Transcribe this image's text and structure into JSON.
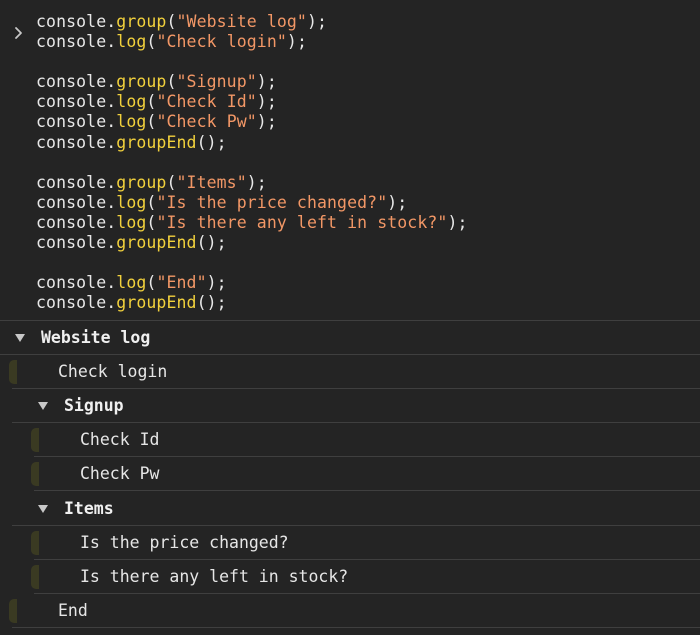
{
  "input": {
    "lines": [
      [
        {
          "t": "obj",
          "v": "console"
        },
        {
          "t": "dot",
          "v": "."
        },
        {
          "t": "fn",
          "v": "group"
        },
        {
          "t": "pun",
          "v": "("
        },
        {
          "t": "str",
          "v": "\"Website log\""
        },
        {
          "t": "pun",
          "v": ");"
        }
      ],
      [
        {
          "t": "obj",
          "v": "console"
        },
        {
          "t": "dot",
          "v": "."
        },
        {
          "t": "fn",
          "v": "log"
        },
        {
          "t": "pun",
          "v": "("
        },
        {
          "t": "str",
          "v": "\"Check login\""
        },
        {
          "t": "pun",
          "v": ");"
        }
      ],
      [],
      [
        {
          "t": "obj",
          "v": "console"
        },
        {
          "t": "dot",
          "v": "."
        },
        {
          "t": "fn",
          "v": "group"
        },
        {
          "t": "pun",
          "v": "("
        },
        {
          "t": "str",
          "v": "\"Signup\""
        },
        {
          "t": "pun",
          "v": ");"
        }
      ],
      [
        {
          "t": "obj",
          "v": "console"
        },
        {
          "t": "dot",
          "v": "."
        },
        {
          "t": "fn",
          "v": "log"
        },
        {
          "t": "pun",
          "v": "("
        },
        {
          "t": "str",
          "v": "\"Check Id\""
        },
        {
          "t": "pun",
          "v": ");"
        }
      ],
      [
        {
          "t": "obj",
          "v": "console"
        },
        {
          "t": "dot",
          "v": "."
        },
        {
          "t": "fn",
          "v": "log"
        },
        {
          "t": "pun",
          "v": "("
        },
        {
          "t": "str",
          "v": "\"Check Pw\""
        },
        {
          "t": "pun",
          "v": ");"
        }
      ],
      [
        {
          "t": "obj",
          "v": "console"
        },
        {
          "t": "dot",
          "v": "."
        },
        {
          "t": "fn",
          "v": "groupEnd"
        },
        {
          "t": "pun",
          "v": "();"
        }
      ],
      [],
      [
        {
          "t": "obj",
          "v": "console"
        },
        {
          "t": "dot",
          "v": "."
        },
        {
          "t": "fn",
          "v": "group"
        },
        {
          "t": "pun",
          "v": "("
        },
        {
          "t": "str",
          "v": "\"Items\""
        },
        {
          "t": "pun",
          "v": ");"
        }
      ],
      [
        {
          "t": "obj",
          "v": "console"
        },
        {
          "t": "dot",
          "v": "."
        },
        {
          "t": "fn",
          "v": "log"
        },
        {
          "t": "pun",
          "v": "("
        },
        {
          "t": "str",
          "v": "\"Is the price changed?\""
        },
        {
          "t": "pun",
          "v": ");"
        }
      ],
      [
        {
          "t": "obj",
          "v": "console"
        },
        {
          "t": "dot",
          "v": "."
        },
        {
          "t": "fn",
          "v": "log"
        },
        {
          "t": "pun",
          "v": "("
        },
        {
          "t": "str",
          "v": "\"Is there any left in stock?\""
        },
        {
          "t": "pun",
          "v": ");"
        }
      ],
      [
        {
          "t": "obj",
          "v": "console"
        },
        {
          "t": "dot",
          "v": "."
        },
        {
          "t": "fn",
          "v": "groupEnd"
        },
        {
          "t": "pun",
          "v": "();"
        }
      ],
      [],
      [
        {
          "t": "obj",
          "v": "console"
        },
        {
          "t": "dot",
          "v": "."
        },
        {
          "t": "fn",
          "v": "log"
        },
        {
          "t": "pun",
          "v": "("
        },
        {
          "t": "str",
          "v": "\"End\""
        },
        {
          "t": "pun",
          "v": ");"
        }
      ],
      [
        {
          "t": "obj",
          "v": "console"
        },
        {
          "t": "dot",
          "v": "."
        },
        {
          "t": "fn",
          "v": "groupEnd"
        },
        {
          "t": "pun",
          "v": "();"
        }
      ]
    ]
  },
  "output": {
    "rows": [
      {
        "kind": "group",
        "depth": 0,
        "label": "Website log",
        "expanded": true
      },
      {
        "kind": "log",
        "depth": 1,
        "label": "Check login"
      },
      {
        "kind": "group",
        "depth": 1,
        "label": "Signup",
        "expanded": true
      },
      {
        "kind": "log",
        "depth": 2,
        "label": "Check Id"
      },
      {
        "kind": "log",
        "depth": 2,
        "label": "Check Pw"
      },
      {
        "kind": "group",
        "depth": 1,
        "label": "Items",
        "expanded": true
      },
      {
        "kind": "log",
        "depth": 2,
        "label": "Is the price changed?"
      },
      {
        "kind": "log",
        "depth": 2,
        "label": "Is there any left in stock?"
      },
      {
        "kind": "log",
        "depth": 1,
        "label": "End"
      }
    ]
  },
  "icons": {
    "prompt": "chevron-right-icon",
    "group_toggle": "triangle-down-icon",
    "gutter": "source-marker-icon"
  },
  "colors": {
    "background": "#242424",
    "function": "#f2d13c",
    "string": "#f29766",
    "text": "#e6e6e6",
    "divider": "#3f3f3f",
    "gutter": "#3a3a22"
  }
}
